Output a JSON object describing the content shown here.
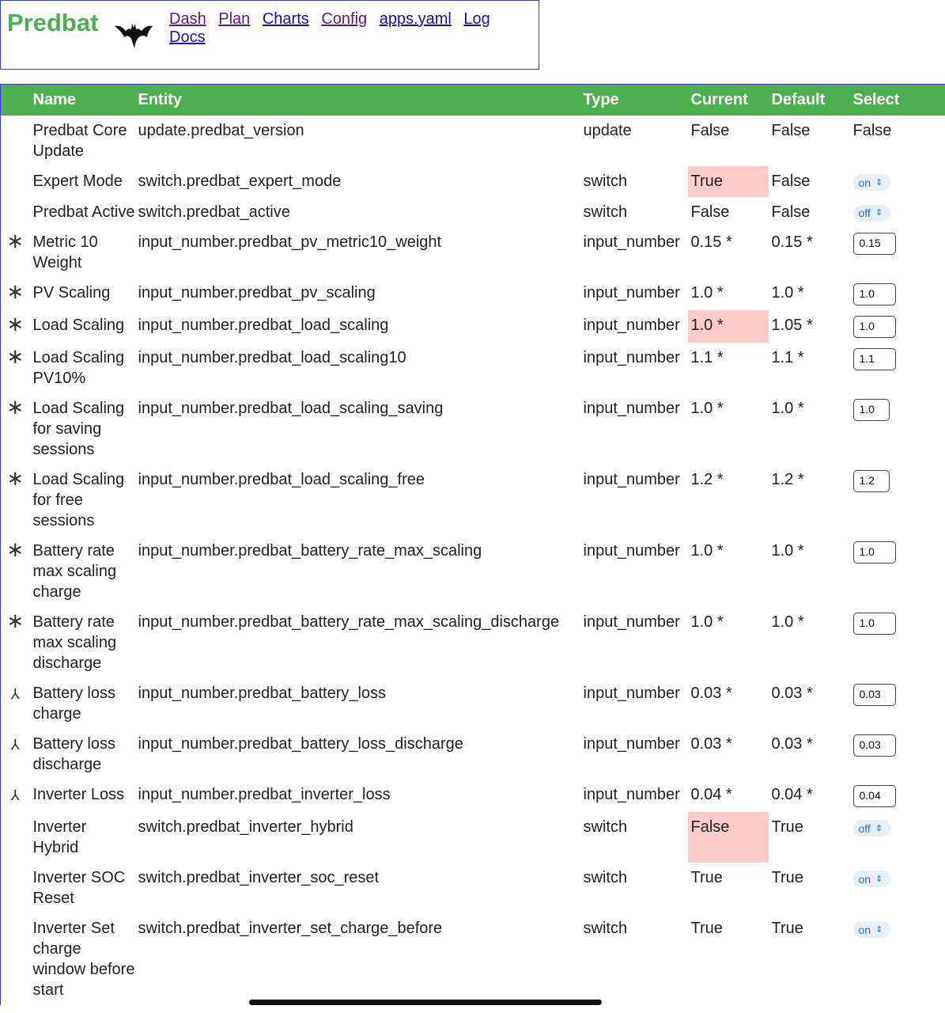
{
  "brand": {
    "name": "Predbat",
    "logo_icon": "bat-icon"
  },
  "nav": [
    "Dash",
    "Plan",
    "Charts",
    "Config",
    "apps.yaml",
    "Log",
    "Docs"
  ],
  "columns": {
    "name": "Name",
    "entity": "Entity",
    "type": "Type",
    "current": "Current",
    "default": "Default",
    "select": "Select"
  },
  "colors": {
    "header_green": "#4caf50",
    "highlight": "#ffcccc",
    "border_blue": "#3b3bb5"
  },
  "rows": [
    {
      "icon": "",
      "name": "Predbat Core Update",
      "entity": "update.predbat_version",
      "type": "update",
      "current": "False",
      "default": "False",
      "select": "False",
      "select_kind": "text",
      "highlight": false
    },
    {
      "icon": "",
      "name": "Expert Mode",
      "entity": "switch.predbat_expert_mode",
      "type": "switch",
      "current": "True",
      "default": "False",
      "select": "on",
      "select_kind": "toggle",
      "highlight": true
    },
    {
      "icon": "",
      "name": "Predbat Active",
      "entity": "switch.predbat_active",
      "type": "switch",
      "current": "False",
      "default": "False",
      "select": "off",
      "select_kind": "toggle",
      "highlight": false
    },
    {
      "icon": "asterisk-icon",
      "name": "Metric 10 Weight",
      "entity": "input_number.predbat_pv_metric10_weight",
      "type": "input_number",
      "current": "0.15 *",
      "default": "0.15 *",
      "select": "0.15",
      "select_kind": "number",
      "highlight": false
    },
    {
      "icon": "asterisk-icon",
      "name": "PV Scaling",
      "entity": "input_number.predbat_pv_scaling",
      "type": "input_number",
      "current": "1.0 *",
      "default": "1.0 *",
      "select": "1.0",
      "select_kind": "number",
      "highlight": false
    },
    {
      "icon": "asterisk-icon",
      "name": "Load Scaling",
      "entity": "input_number.predbat_load_scaling",
      "type": "input_number",
      "current": "1.0 *",
      "default": "1.05 *",
      "select": "1.0",
      "select_kind": "number",
      "highlight": true
    },
    {
      "icon": "asterisk-icon",
      "name": "Load Scaling PV10%",
      "entity": "input_number.predbat_load_scaling10",
      "type": "input_number",
      "current": "1.1 *",
      "default": "1.1 *",
      "select": "1.1",
      "select_kind": "number",
      "highlight": false
    },
    {
      "icon": "asterisk-icon",
      "name": "Load Scaling for saving sessions",
      "entity": "input_number.predbat_load_scaling_saving",
      "type": "input_number",
      "current": "1.0 *",
      "default": "1.0 *",
      "select": "1.0",
      "select_kind": "number-narrow",
      "highlight": false
    },
    {
      "icon": "asterisk-icon",
      "name": "Load Scaling for free sessions",
      "entity": "input_number.predbat_load_scaling_free",
      "type": "input_number",
      "current": "1.2 *",
      "default": "1.2 *",
      "select": "1.2",
      "select_kind": "number-narrow",
      "highlight": false
    },
    {
      "icon": "asterisk-icon",
      "name": "Battery rate max scaling charge",
      "entity": "input_number.predbat_battery_rate_max_scaling",
      "type": "input_number",
      "current": "1.0 *",
      "default": "1.0 *",
      "select": "1.0",
      "select_kind": "number",
      "highlight": false
    },
    {
      "icon": "asterisk-icon",
      "name": "Battery rate max scaling discharge",
      "entity": "input_number.predbat_battery_rate_max_scaling_discharge",
      "type": "input_number",
      "current": "1.0 *",
      "default": "1.0 *",
      "select": "1.0",
      "select_kind": "number",
      "highlight": false
    },
    {
      "icon": "loss-icon",
      "name": "Battery loss charge",
      "entity": "input_number.predbat_battery_loss",
      "type": "input_number",
      "current": "0.03 *",
      "default": "0.03 *",
      "select": "0.03",
      "select_kind": "number",
      "highlight": false
    },
    {
      "icon": "loss-icon",
      "name": "Battery loss discharge",
      "entity": "input_number.predbat_battery_loss_discharge",
      "type": "input_number",
      "current": "0.03 *",
      "default": "0.03 *",
      "select": "0.03",
      "select_kind": "number",
      "highlight": false
    },
    {
      "icon": "loss-icon",
      "name": "Inverter Loss",
      "entity": "input_number.predbat_inverter_loss",
      "type": "input_number",
      "current": "0.04 *",
      "default": "0.04 *",
      "select": "0.04",
      "select_kind": "number",
      "highlight": false
    },
    {
      "icon": "",
      "name": "Inverter Hybrid",
      "entity": "switch.predbat_inverter_hybrid",
      "type": "switch",
      "current": "False",
      "default": "True",
      "select": "off",
      "select_kind": "toggle",
      "highlight": true
    },
    {
      "icon": "",
      "name": "Inverter SOC Reset",
      "entity": "switch.predbat_inverter_soc_reset",
      "type": "switch",
      "current": "True",
      "default": "True",
      "select": "on",
      "select_kind": "toggle",
      "highlight": false
    },
    {
      "icon": "",
      "name": "Inverter Set charge window before start",
      "entity": "switch.predbat_inverter_set_charge_before",
      "type": "switch",
      "current": "True",
      "default": "True",
      "select": "on",
      "select_kind": "toggle",
      "highlight": false
    }
  ]
}
